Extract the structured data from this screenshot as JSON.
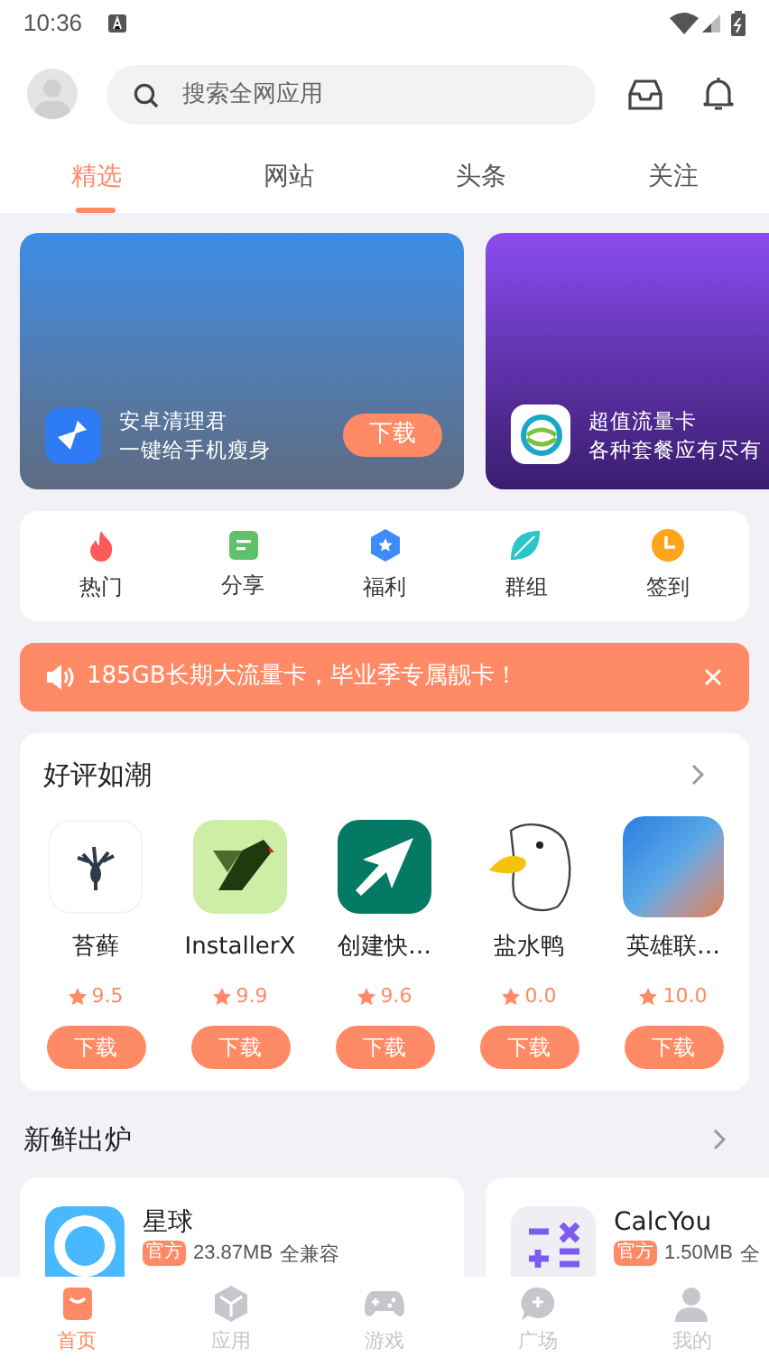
{
  "status_bar": {
    "time": "10:36"
  },
  "search": {
    "placeholder": "搜索全网应用"
  },
  "tabs": [
    {
      "label": "精选",
      "selected": true
    },
    {
      "label": "网站",
      "selected": false
    },
    {
      "label": "头条",
      "selected": false
    },
    {
      "label": "关注",
      "selected": false
    }
  ],
  "banners": [
    {
      "kind": "cleaner",
      "title": "安卓清理君",
      "subtitle": "一键给手机瘦身",
      "button": "下载"
    },
    {
      "kind": "carrier",
      "title": "超值流量卡",
      "subtitle": "各种套餐应有尽有"
    }
  ],
  "shortcuts": [
    {
      "kind": "fire",
      "label": "热门"
    },
    {
      "kind": "share",
      "label": "分享"
    },
    {
      "kind": "gift",
      "label": "福利"
    },
    {
      "kind": "leaf",
      "label": "群组"
    },
    {
      "kind": "clock",
      "label": "签到"
    }
  ],
  "notice": {
    "text": "185GB长期大流量卡，毕业季专属靓卡！"
  },
  "rated": {
    "title": "好评如潮",
    "apps": [
      {
        "kind": "tree",
        "name": "苔藓",
        "rating": "9.5",
        "button": "下载"
      },
      {
        "kind": "bird",
        "name": "InstallerX",
        "rating": "9.9",
        "button": "下载"
      },
      {
        "kind": "arrow",
        "name": "创建快…",
        "rating": "9.6",
        "button": "下载"
      },
      {
        "kind": "duck",
        "name": "盐水鸭",
        "rating": "0.0",
        "button": "下载"
      },
      {
        "kind": "game",
        "name": "英雄联…",
        "rating": "10.0",
        "button": "下载"
      }
    ]
  },
  "fresh": {
    "title": "新鲜出炉",
    "apps": [
      {
        "kind": "ring",
        "name": "星球",
        "tag": "官方",
        "size": "23.87MB",
        "compat": "全兼容"
      },
      {
        "kind": "calc",
        "name": "CalcYou",
        "tag": "官方",
        "size": "1.50MB",
        "compat": "全"
      }
    ]
  },
  "nav": [
    {
      "kind": "home",
      "label": "首页",
      "selected": true
    },
    {
      "kind": "cube",
      "label": "应用",
      "selected": false
    },
    {
      "kind": "gamepad",
      "label": "游戏",
      "selected": false
    },
    {
      "kind": "chat",
      "label": "广场",
      "selected": false
    },
    {
      "kind": "user",
      "label": "我的",
      "selected": false
    }
  ]
}
